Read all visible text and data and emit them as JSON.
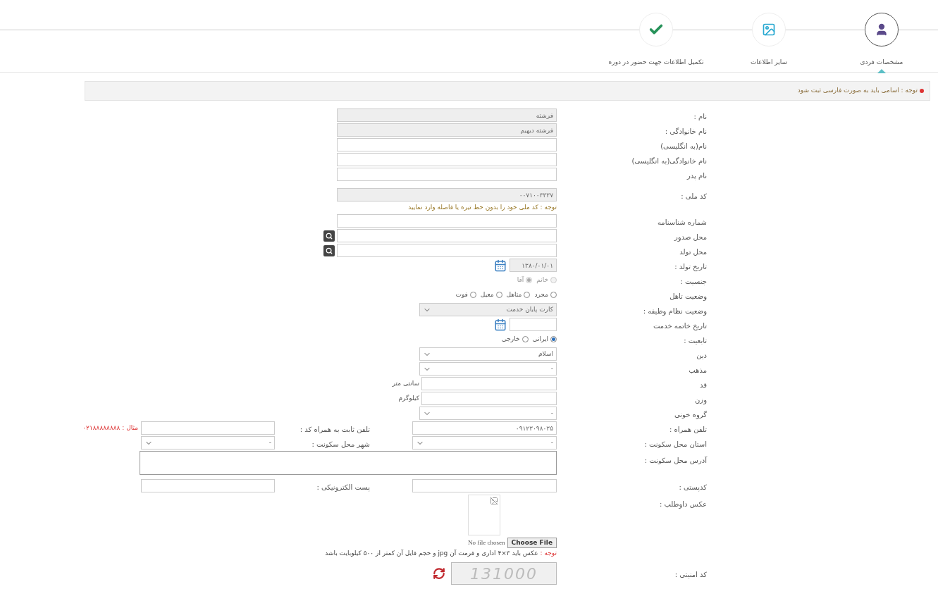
{
  "steps": [
    {
      "kind": "person",
      "label": "مشخصات فردی",
      "selected": true
    },
    {
      "kind": "image",
      "label": "سایر اطلاعات",
      "selected": false
    },
    {
      "kind": "check",
      "label": "تکمیل اطلاعات جهت حضور در دوره",
      "selected": false
    }
  ],
  "notice": {
    "text": "توجه : اسامی باید به صورت فارسی ثبت شود"
  },
  "fields": [
    {
      "kind": "text",
      "label": "نام :",
      "value": "فرشته",
      "disabled": true
    },
    {
      "kind": "text",
      "label": "نام خانوادگی :",
      "value": "فرشته دیهیم",
      "disabled": true
    },
    {
      "kind": "text",
      "label": "نام(به انگلیسی)",
      "disabled": false
    },
    {
      "kind": "text",
      "label": "نام خانوادگی(به انگلیسی)",
      "disabled": false
    },
    {
      "kind": "text",
      "label": "نام پدر",
      "disabled": false
    },
    {
      "kind": "gap"
    },
    {
      "kind": "text",
      "label": "کد ملی :",
      "value": "۰۰۷۱۰۰۳۳۳۷",
      "disabled": true
    },
    {
      "kind": "note",
      "text": "توجه : کد ملی خود را بدون خط تیره یا فاصله وارد نمایید"
    },
    {
      "kind": "text",
      "label": "شماره شناسنامه",
      "disabled": false
    },
    {
      "kind": "search",
      "label": "محل صدور"
    },
    {
      "kind": "search",
      "label": "محل تولد"
    },
    {
      "kind": "date",
      "label": "تاریخ تولد :",
      "value": "۱۳۸۰/۰۱/۰۱",
      "disabled": true
    },
    {
      "kind": "radio",
      "label": "جنسیت :",
      "disabled": true,
      "options": [
        {
          "label": "خانم",
          "selected": false
        },
        {
          "label": "آقا",
          "selected": true
        }
      ]
    },
    {
      "kind": "radio",
      "label": "وضعیت تاهل",
      "disabled": false,
      "options": [
        {
          "label": "مجرد",
          "selected": false
        },
        {
          "label": "متاهل",
          "selected": false
        },
        {
          "label": "معیل",
          "selected": false
        },
        {
          "label": "فوت",
          "selected": false
        }
      ]
    },
    {
      "kind": "select",
      "label": "وضعیت نظام وظیفه :",
      "value": "کارت پایان خدمت",
      "disabled": true
    },
    {
      "kind": "date",
      "label": "تاریخ خاتمه خدمت",
      "disabled": false
    },
    {
      "kind": "radio",
      "label": "تابعیت :",
      "disabled": false,
      "options": [
        {
          "label": "ایرانی",
          "selected": true
        },
        {
          "label": "خارجی",
          "selected": false
        }
      ]
    },
    {
      "kind": "select",
      "label": "دین",
      "value": "اسلام",
      "disabled": false
    },
    {
      "kind": "select",
      "label": "مذهب",
      "value": "-",
      "disabled": false
    },
    {
      "kind": "unit",
      "label": "قد",
      "unit": "سانتی متر"
    },
    {
      "kind": "unit",
      "label": "وزن",
      "unit": "کیلوگرم"
    },
    {
      "kind": "select",
      "label": "گروه خونی",
      "value": "-",
      "disabled": false
    },
    {
      "kind": "text",
      "label": "تلفن همراه :",
      "value": "۰۹۱۲۳۰۹۸۰۳۵",
      "disabled": false,
      "secondary": {
        "kind": "text",
        "label": "تلفن ثابت به همراه کد :",
        "hint": "مثال : ۰۲۱۸۸۸۸۸۸۸۸"
      }
    },
    {
      "kind": "select",
      "label": "استان محل سکونت :",
      "value": "-",
      "disabled": false,
      "secondary": {
        "kind": "select",
        "label": "شهر محل سکونت :",
        "value": "-"
      }
    },
    {
      "kind": "textarea",
      "label": "آدرس محل سکونت :"
    },
    {
      "kind": "text",
      "label": "کدپستی :",
      "disabled": false,
      "secondary": {
        "kind": "text",
        "label": "پست الکترونیکی :"
      }
    },
    {
      "kind": "photo",
      "label": "عکس داوطلب :",
      "file_status": "No file chosen",
      "button": "Choose File"
    },
    {
      "kind": "note",
      "prefix": "توجه :",
      "text": "عکس باید ۳×۴ اداری و فرمت آن jpg و حجم فایل آن کمتر از ۵۰۰ کیلوبایت باشد"
    },
    {
      "kind": "captcha",
      "label": "کد امنیتی :",
      "code": "131000"
    }
  ]
}
